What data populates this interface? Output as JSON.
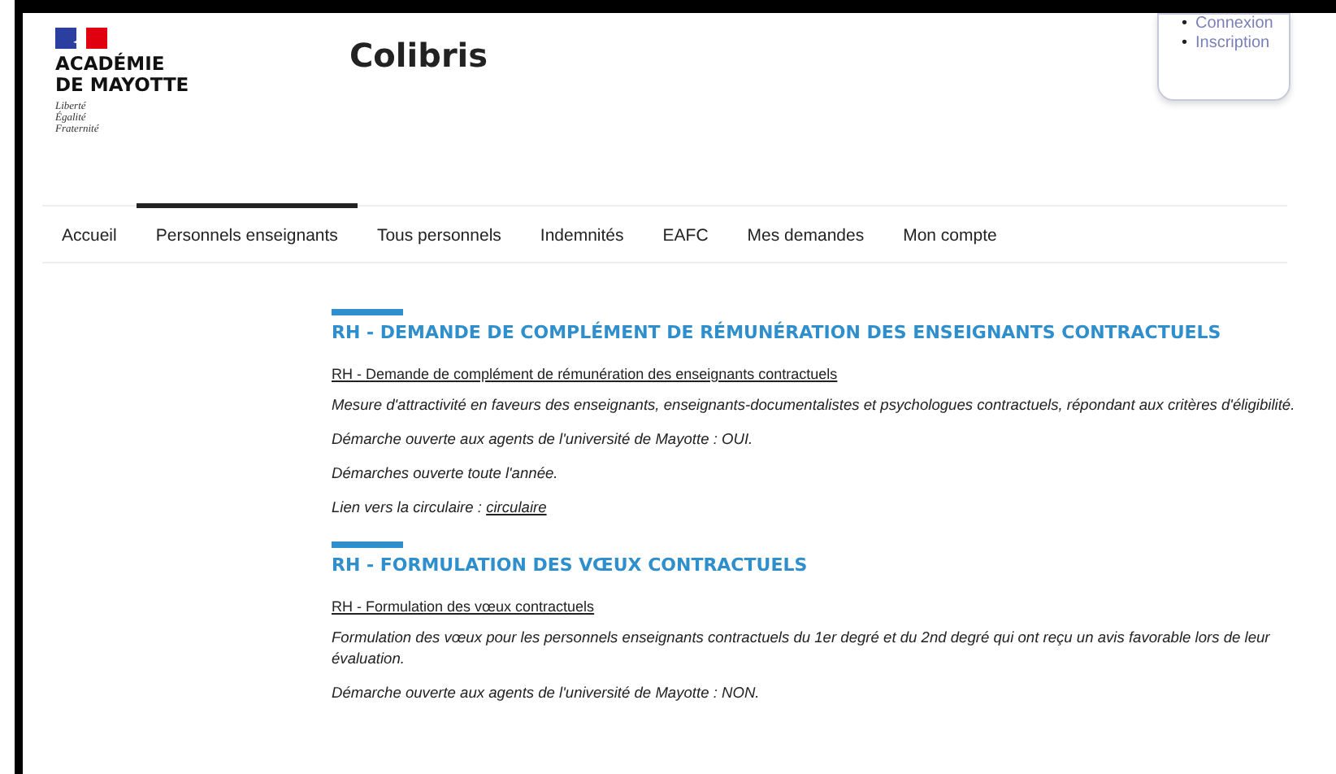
{
  "header": {
    "brand": {
      "name_lines": [
        "ACADÉMIE",
        "DE MAYOTTE"
      ],
      "motto": [
        "Liberté",
        "Égalité",
        "Fraternité"
      ]
    },
    "site_title": "Colibris",
    "account_links": [
      {
        "marker": "•",
        "label": "Connexion"
      },
      {
        "marker": "•",
        "label": "Inscription"
      }
    ]
  },
  "nav": {
    "items": [
      {
        "label": "Accueil",
        "selected": false
      },
      {
        "label": "Personnels enseignants",
        "selected": true
      },
      {
        "label": "Tous personnels",
        "selected": false
      },
      {
        "label": "Indemnités",
        "selected": false
      },
      {
        "label": "EAFC",
        "selected": false
      },
      {
        "label": "Mes demandes",
        "selected": false
      },
      {
        "label": "Mon compte",
        "selected": false
      }
    ]
  },
  "sections": [
    {
      "title": "RH - DEMANDE DE COMPLÉMENT DE RÉMUNÉRATION DES ENSEIGNANTS CONTRACTUELS",
      "link": "RH - Demande de complément de rémunération des enseignants contractuels",
      "paragraphs": [
        {
          "text": "Mesure d'attractivité en faveurs des enseignants, enseignants-documentalistes et psychologues contractuels, répondant aux critères d'éligibilité."
        },
        {
          "text": "Démarche ouverte aux agents de l'université de Mayotte : OUI."
        },
        {
          "text": "Démarches ouverte toute l'année."
        },
        {
          "text": "Lien vers la circulaire : ",
          "link": "circulaire"
        }
      ]
    },
    {
      "title": "RH - FORMULATION DES VŒUX CONTRACTUELS",
      "link": "RH - Formulation des vœux contractuels",
      "paragraphs": [
        {
          "text": "Formulation des vœux pour les personnels enseignants contractuels du 1er degré et du 2nd degré qui ont reçu un avis favorable lors de leur évaluation."
        },
        {
          "text": "Démarche ouverte aux agents de l'université de Mayotte : NON."
        }
      ]
    }
  ]
}
